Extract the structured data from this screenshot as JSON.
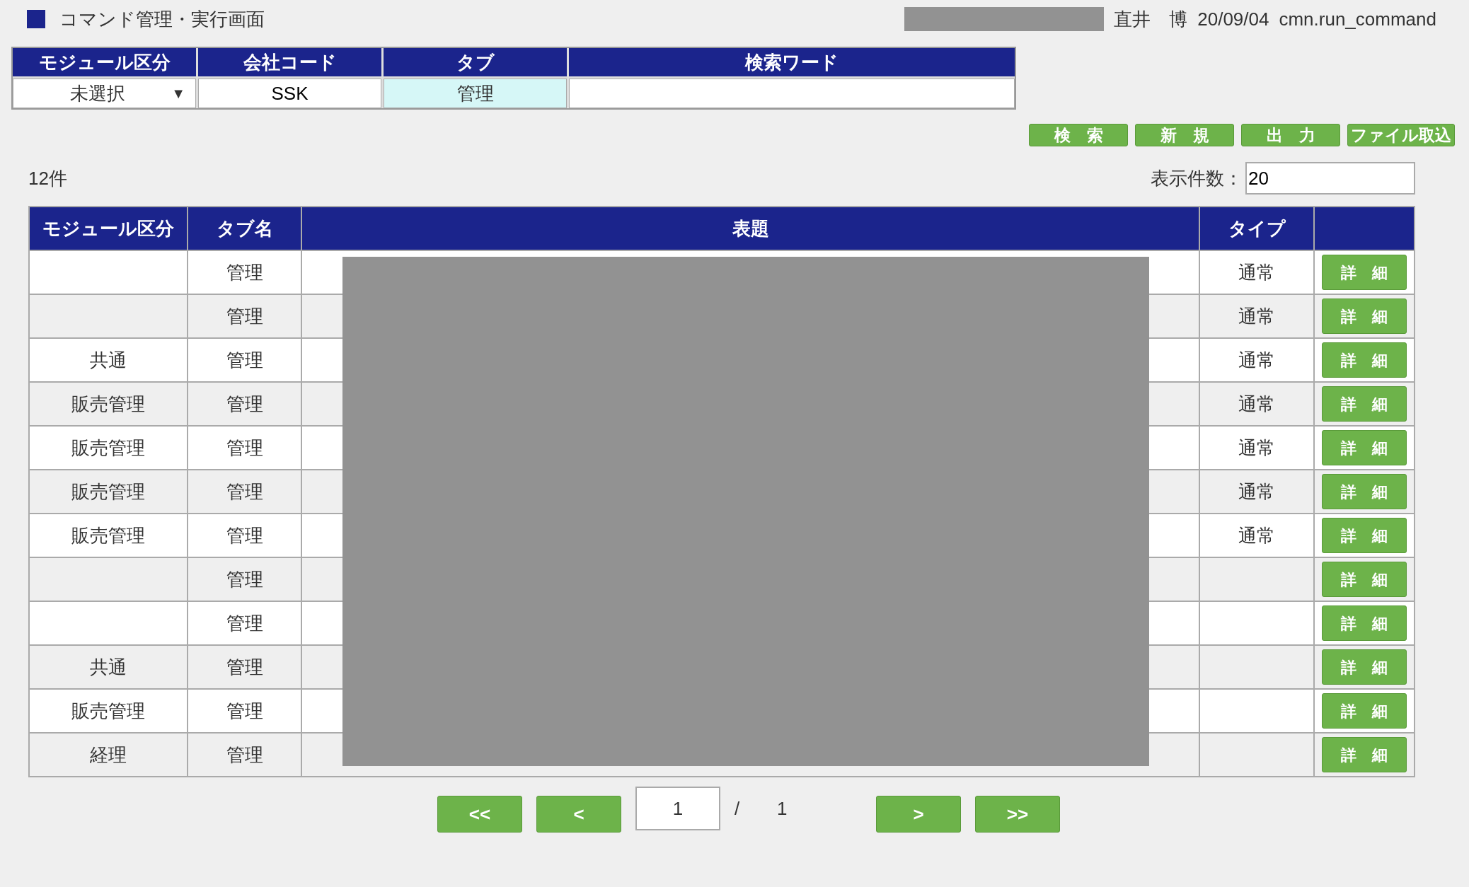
{
  "page_title": "コマンド管理・実行画面",
  "header_info": {
    "user": "直井　博",
    "date": "20/09/04",
    "program": "cmn.run_command"
  },
  "filter": {
    "columns": [
      "モジュール区分",
      "会社コード",
      "タブ",
      "検索ワード"
    ],
    "module_select": {
      "value": "未選択",
      "arrow": "▼"
    },
    "company_code": "SSK",
    "tab": "管理"
  },
  "actions": [
    "検　索",
    "新　規",
    "出　力",
    "ファイル取込"
  ],
  "count": "12件",
  "page_size": {
    "label": "表示件数：",
    "value": "20"
  },
  "table": {
    "columns": [
      "モジュール区分",
      "タブ名",
      "表題",
      "タイプ"
    ],
    "rows": [
      {
        "module": "",
        "tab": "管理",
        "type": "通常",
        "detail": "詳　細"
      },
      {
        "module": "",
        "tab": "管理",
        "type": "通常",
        "detail": "詳　細"
      },
      {
        "module": "共通",
        "tab": "管理",
        "type": "通常",
        "detail": "詳　細"
      },
      {
        "module": "販売管理",
        "tab": "管理",
        "type": "通常",
        "detail": "詳　細"
      },
      {
        "module": "販売管理",
        "tab": "管理",
        "type": "通常",
        "detail": "詳　細"
      },
      {
        "module": "販売管理",
        "tab": "管理",
        "type": "通常",
        "detail": "詳　細"
      },
      {
        "module": "販売管理",
        "tab": "管理",
        "type": "通常",
        "detail": "詳　細"
      },
      {
        "module": "",
        "tab": "管理",
        "type": "",
        "detail": "詳　細"
      },
      {
        "module": "",
        "tab": "管理",
        "type": "",
        "detail": "詳　細"
      },
      {
        "module": "共通",
        "tab": "管理",
        "type": "",
        "detail": "詳　細"
      },
      {
        "module": "販売管理",
        "tab": "管理",
        "type": "",
        "detail": "詳　細"
      },
      {
        "module": "経理",
        "tab": "管理",
        "type": "",
        "detail": "詳　細"
      }
    ]
  },
  "pagination": {
    "first": "<<",
    "prev": "<",
    "current": "1",
    "separator": "/",
    "total": "1",
    "next": ">",
    "last": ">>"
  }
}
